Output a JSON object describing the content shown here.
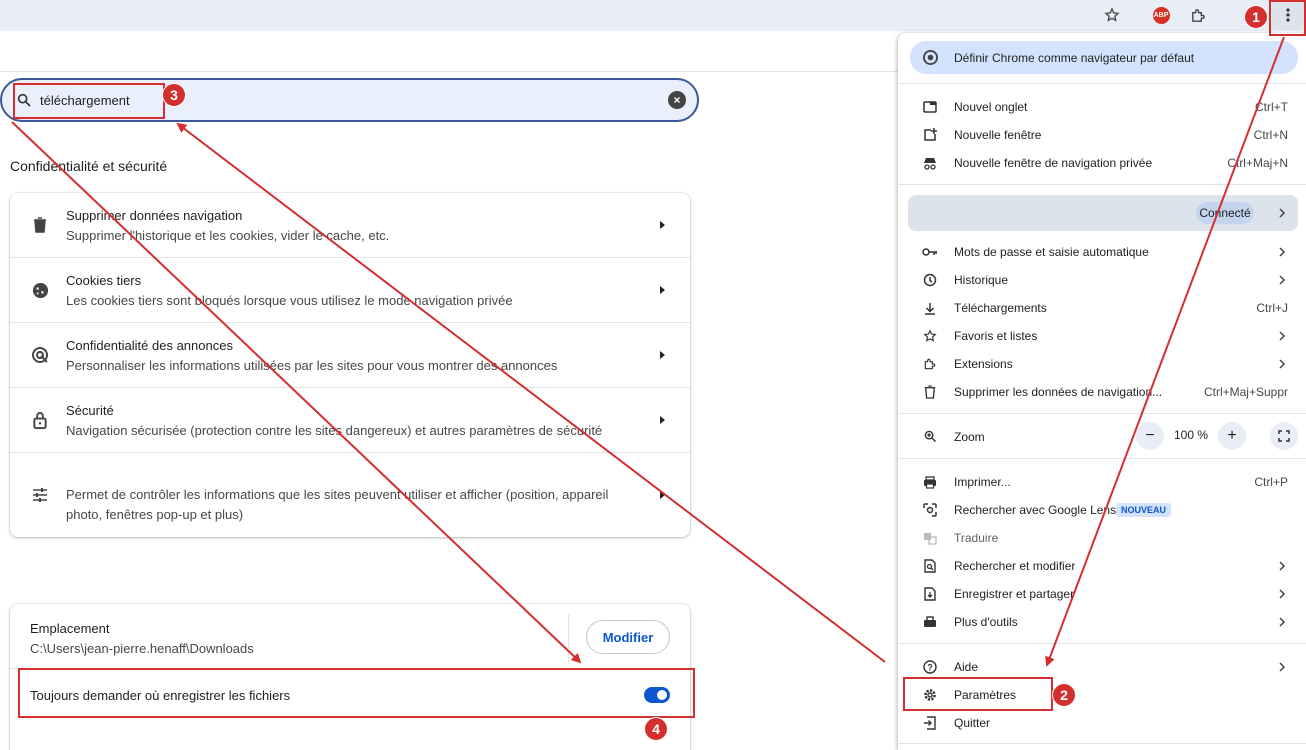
{
  "toolbar": {
    "star_icon": "star-icon",
    "adblock_label": "ABP",
    "extensions_icon": "puzzle-icon",
    "menu_icon": "kebab-menu-icon"
  },
  "search": {
    "value": "téléchargement",
    "icon": "search-icon",
    "clear_icon": "clear-icon"
  },
  "privacy": {
    "title": "Confidentialité et sécurité",
    "rows": [
      {
        "icon": "trash-icon",
        "title": "Supprimer données navigation",
        "sub": "Supprimer l'historique et les cookies, vider le cache, etc."
      },
      {
        "icon": "cookie-icon",
        "title": "Cookies tiers",
        "sub": "Les cookies tiers sont bloqués lorsque vous utilisez le mode navigation privée"
      },
      {
        "icon": "ad-privacy-icon",
        "title": "Confidentialité des annonces",
        "sub": "Personnaliser les informations utilisées par les sites pour vous montrer des annonces"
      },
      {
        "icon": "lock-icon",
        "title": "Sécurité",
        "sub": "Navigation sécurisée (protection contre les sites dangereux) et autres paramètres de sécurité"
      },
      {
        "icon": "sliders-icon",
        "title": "",
        "sub": "Permet de contrôler les informations que les sites peuvent utiliser et afficher (position, appareil photo, fenêtres pop-up et plus)"
      }
    ]
  },
  "downloads": {
    "location_label": "Emplacement",
    "location_path": "C:\\Users\\jean-pierre.henaff\\Downloads",
    "modify_button": "Modifier",
    "ask_label": "Toujours demander où enregistrer les fichiers",
    "ask_enabled": true
  },
  "menu": {
    "default_browser": "Définir Chrome comme navigateur par défaut",
    "items": [
      {
        "icon": "new-tab-icon",
        "label": "Nouvel onglet",
        "shortcut": "Ctrl+T"
      },
      {
        "icon": "new-window-icon",
        "label": "Nouvelle fenêtre",
        "shortcut": "Ctrl+N"
      },
      {
        "icon": "incognito-icon",
        "label": "Nouvelle fenêtre de navigation privée",
        "shortcut": "Ctrl+Maj+N"
      }
    ],
    "profile_status": "Connecté",
    "items2": [
      {
        "icon": "key-icon",
        "label": "Mots de passe et saisie automatique",
        "shortcut": ""
      },
      {
        "icon": "history-icon",
        "label": "Historique",
        "shortcut": ""
      },
      {
        "icon": "download-icon",
        "label": "Téléchargements",
        "shortcut": "Ctrl+J"
      },
      {
        "icon": "star-icon",
        "label": "Favoris et listes",
        "shortcut": ""
      },
      {
        "icon": "puzzle-icon",
        "label": "Extensions",
        "shortcut": ""
      },
      {
        "icon": "trash-icon",
        "label": "Supprimer les données de navigation...",
        "shortcut": "Ctrl+Maj+Suppr"
      }
    ],
    "zoom_label": "Zoom",
    "zoom_value": "100 %",
    "zoom_minus": "−",
    "zoom_plus": "+",
    "items3": [
      {
        "icon": "print-icon",
        "label": "Imprimer...",
        "shortcut": "Ctrl+P"
      },
      {
        "icon": "lens-icon",
        "label": "Rechercher avec Google Lens",
        "shortcut": ""
      },
      {
        "icon": "translate-icon",
        "label": "Traduire",
        "shortcut": ""
      },
      {
        "icon": "find-icon",
        "label": "Rechercher et modifier",
        "shortcut": ""
      },
      {
        "icon": "save-share-icon",
        "label": "Enregistrer et partager",
        "shortcut": ""
      },
      {
        "icon": "tools-icon",
        "label": "Plus d'outils",
        "shortcut": ""
      }
    ],
    "lens_badge": "NOUVEAU",
    "help": "Aide",
    "settings": "Paramètres",
    "quit": "Quitter"
  },
  "annotations": {
    "step1": "1",
    "step2": "2",
    "step3": "3",
    "step4": "4",
    "color": "#d32f2f"
  }
}
